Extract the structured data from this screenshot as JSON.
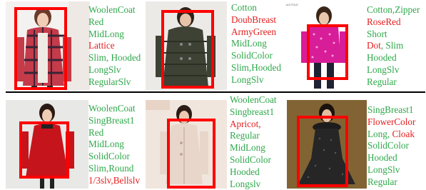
{
  "colors": {
    "attribute_green": "#2ea84a",
    "attribute_red": "#e41e1e",
    "bbox_red": "#ff0000",
    "divider": "#000000"
  },
  "photo_caption_small": "A/CTDLE",
  "panels": [
    {
      "lines": [
        [
          {
            "t": "WoolenCoat",
            "c": "g"
          }
        ],
        [
          {
            "t": "Red",
            "c": "g"
          }
        ],
        [
          {
            "t": "MidLong",
            "c": "g"
          }
        ],
        [
          {
            "t": "Lattice",
            "c": "r"
          }
        ],
        [
          {
            "t": "Slim, Hooded",
            "c": "g"
          }
        ],
        [
          {
            "t": "LongSlv",
            "c": "g"
          }
        ],
        [
          {
            "t": "RegularSlv",
            "c": "g"
          }
        ]
      ]
    },
    {
      "lines": [
        [
          {
            "t": "Cotton",
            "c": "g"
          }
        ],
        [
          {
            "t": "DoubBreast",
            "c": "r"
          }
        ],
        [
          {
            "t": "ArmyGreen",
            "c": "r"
          }
        ],
        [
          {
            "t": "MidLong",
            "c": "g"
          }
        ],
        [
          {
            "t": "SolidColor",
            "c": "g"
          }
        ],
        [
          {
            "t": "Slim,Hooded",
            "c": "g"
          }
        ],
        [
          {
            "t": "LongSlv",
            "c": "g"
          }
        ]
      ]
    },
    {
      "lines": [
        [
          {
            "t": "Cotton,Zipper",
            "c": "g"
          }
        ],
        [
          {
            "t": "RoseRed",
            "c": "r"
          }
        ],
        [
          {
            "t": "Short",
            "c": "g"
          }
        ],
        [
          {
            "t": "Dot",
            "c": "r"
          },
          {
            "t": ", Slim",
            "c": "g"
          }
        ],
        [
          {
            "t": "Hooded",
            "c": "g"
          }
        ],
        [
          {
            "t": "LongSlv",
            "c": "g"
          }
        ],
        [
          {
            "t": "Regular",
            "c": "g"
          }
        ]
      ]
    },
    {
      "lines": [
        [
          {
            "t": "WoolenCoat",
            "c": "g"
          }
        ],
        [
          {
            "t": "SingBreast1",
            "c": "g"
          }
        ],
        [
          {
            "t": "Red",
            "c": "g"
          }
        ],
        [
          {
            "t": "MidLong",
            "c": "g"
          }
        ],
        [
          {
            "t": "SolidColor",
            "c": "g"
          }
        ],
        [
          {
            "t": "Slim,Round",
            "c": "g"
          }
        ],
        [
          {
            "t": "1/3slv,",
            "c": "r"
          },
          {
            "t": "Bellslv",
            "c": "r"
          }
        ]
      ]
    },
    {
      "lines": [
        [
          {
            "t": "WoolenCoat",
            "c": "g"
          }
        ],
        [
          {
            "t": "Singbreast1",
            "c": "g"
          }
        ],
        [
          {
            "t": "Apricot,",
            "c": "r"
          }
        ],
        [
          {
            "t": "Regular",
            "c": "g"
          }
        ],
        [
          {
            "t": "MidLong",
            "c": "g"
          }
        ],
        [
          {
            "t": "SolidColor",
            "c": "g"
          }
        ],
        [
          {
            "t": "Hooded",
            "c": "g"
          }
        ],
        [
          {
            "t": "Longslv",
            "c": "g"
          }
        ]
      ]
    },
    {
      "lines": [
        [
          {
            "t": "SingBreast1",
            "c": "g"
          }
        ],
        [
          {
            "t": "FlowerColor",
            "c": "r"
          }
        ],
        [
          {
            "t": "Long, ",
            "c": "g"
          },
          {
            "t": "Cloak",
            "c": "r"
          }
        ],
        [
          {
            "t": "SolidColor",
            "c": "g"
          }
        ],
        [
          {
            "t": "Hooded",
            "c": "g"
          }
        ],
        [
          {
            "t": "LongSlv",
            "c": "g"
          }
        ],
        [
          {
            "t": "Regular",
            "c": "g"
          }
        ]
      ]
    }
  ]
}
